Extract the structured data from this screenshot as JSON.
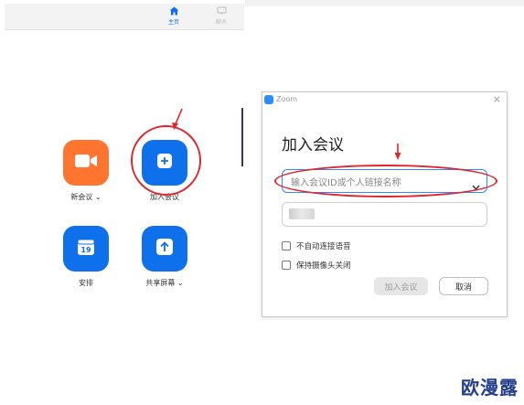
{
  "nav": {
    "home_label": "主页",
    "chat_label": "聊天",
    "home_icon": "home-icon",
    "chat_icon": "chat-icon",
    "accent": "#0e71eb"
  },
  "actions": {
    "new_meeting": {
      "label": "新会议",
      "caret": "⌄",
      "icon": "video-camera-icon",
      "color": "#ff7530"
    },
    "join": {
      "label": "加入会议",
      "icon": "plus-icon",
      "color": "#0e71eb"
    },
    "schedule": {
      "label": "安排",
      "icon": "calendar-icon",
      "day": "19",
      "color": "#0e71eb"
    },
    "share": {
      "label": "共享屏幕",
      "caret": "⌄",
      "icon": "share-up-arrow-icon",
      "color": "#0e71eb"
    }
  },
  "dialog": {
    "app_name": "Zoom",
    "close": "×",
    "heading": "加入会议",
    "meeting_placeholder": "输入会议ID或个人链接名称",
    "options": [
      "不自动连接语音",
      "保持摄像头关闭"
    ],
    "join_button": "加入会议",
    "cancel_button": "取消"
  },
  "annotations": {
    "color": "#e0272d"
  },
  "watermark": "欧漫露"
}
